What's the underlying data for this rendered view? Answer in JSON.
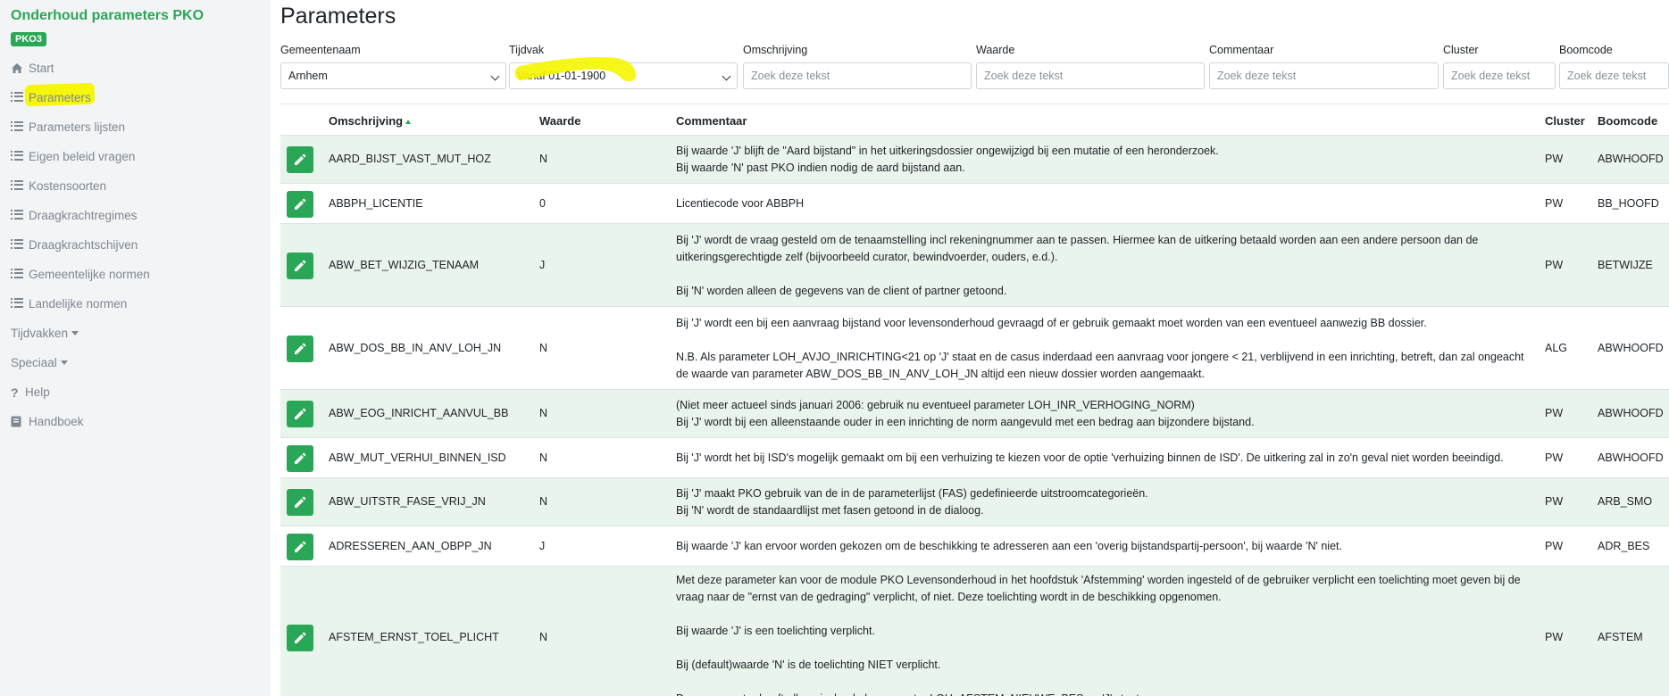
{
  "app": {
    "title": "Onderhoud parameters PKO",
    "badge": "PKO3"
  },
  "sidebar": {
    "items": [
      {
        "label": "Start",
        "icon": "home-icon"
      },
      {
        "label": "Parameters",
        "icon": "list-icon"
      },
      {
        "label": "Parameters lijsten",
        "icon": "list-icon"
      },
      {
        "label": "Eigen beleid vragen",
        "icon": "list-icon"
      },
      {
        "label": "Kostensoorten",
        "icon": "list-icon"
      },
      {
        "label": "Draagkrachtregimes",
        "icon": "list-icon"
      },
      {
        "label": "Draagkrachtschijven",
        "icon": "list-icon"
      },
      {
        "label": "Gemeentelijke normen",
        "icon": "list-icon"
      },
      {
        "label": "Landelijke normen",
        "icon": "list-icon"
      },
      {
        "label": "Tijdvakken",
        "icon": "dropdown-caret"
      },
      {
        "label": "Speciaal",
        "icon": "dropdown-caret"
      },
      {
        "label": "Help",
        "icon": "question-icon"
      },
      {
        "label": "Handboek",
        "icon": "book-icon"
      }
    ]
  },
  "page": {
    "title": "Parameters"
  },
  "filters": {
    "gemeentenaam": {
      "label": "Gemeentenaam",
      "value": "Arnhem"
    },
    "tijdvak": {
      "label": "Tijdvak",
      "value": "Vanaf 01-01-1900"
    },
    "omschrijving": {
      "label": "Omschrijving",
      "placeholder": "Zoek deze tekst"
    },
    "waarde": {
      "label": "Waarde",
      "placeholder": "Zoek deze tekst"
    },
    "commentaar": {
      "label": "Commentaar",
      "placeholder": "Zoek deze tekst"
    },
    "cluster": {
      "label": "Cluster",
      "placeholder": "Zoek deze tekst"
    },
    "boomcode": {
      "label": "Boomcode",
      "placeholder": "Zoek deze tekst"
    }
  },
  "table": {
    "headers": {
      "omschrijving": "Omschrijving",
      "waarde": "Waarde",
      "commentaar": "Commentaar",
      "cluster": "Cluster",
      "boomcode": "Boomcode"
    },
    "rows": [
      {
        "omschrijving": "AARD_BIJST_VAST_MUT_HOZ",
        "waarde": "N",
        "commentaar": "Bij waarde 'J' blijft de \"Aard bijstand\" in het uitkeringsdossier ongewijzigd bij een mutatie of een heronderzoek.\nBij waarde 'N' past PKO indien nodig de aard bijstand aan.",
        "cluster": "PW",
        "boomcode": "ABWHOOFD"
      },
      {
        "omschrijving": "ABBPH_LICENTIE",
        "waarde": "0",
        "commentaar": "Licentiecode voor ABBPH",
        "cluster": "PW",
        "boomcode": "BB_HOOFD"
      },
      {
        "omschrijving": "ABW_BET_WIJZIG_TENAAM",
        "waarde": "J",
        "commentaar": "Bij 'J' wordt de vraag gesteld om de tenaamstelling incl rekeningnummer aan te passen. Hiermee kan de uitkering betaald worden aan een andere persoon dan de\nuitkeringsgerechtigde zelf (bijvoorbeeld curator, bewindvoerder, ouders, e.d.).\n\nBij 'N' worden alleen de gegevens van de client of partner getoond.",
        "cluster": "PW",
        "boomcode": "BETWIJZE"
      },
      {
        "omschrijving": "ABW_DOS_BB_IN_ANV_LOH_JN",
        "waarde": "N",
        "commentaar": "Bij 'J' wordt een bij een aanvraag bijstand voor levensonderhoud gevraagd of er gebruik gemaakt moet worden van een eventueel aanwezig BB dossier.\n\nN.B. Als parameter LOH_AVJO_INRICHTING<21 op 'J' staat en de casus inderdaad een aanvraag voor jongere < 21, verblijvend in een inrichting, betreft, dan zal ongeacht\nde waarde van parameter ABW_DOS_BB_IN_ANV_LOH_JN altijd een nieuw dossier worden aangemaakt.",
        "cluster": "ALG",
        "boomcode": "ABWHOOFD"
      },
      {
        "omschrijving": "ABW_EOG_INRICHT_AANVUL_BB",
        "waarde": "N",
        "commentaar": "(Niet meer actueel sinds januari 2006: gebruik nu eventueel parameter LOH_INR_VERHOGING_NORM)\nBij 'J' wordt bij een alleenstaande ouder in een inrichting de norm aangevuld met een bedrag aan bijzondere bijstand.",
        "cluster": "PW",
        "boomcode": "ABWHOOFD"
      },
      {
        "omschrijving": "ABW_MUT_VERHUI_BINNEN_ISD",
        "waarde": "N",
        "commentaar": "Bij 'J' wordt het bij ISD's mogelijk gemaakt om bij een verhuizing te kiezen voor de optie 'verhuizing binnen de ISD'. De uitkering zal in zo'n geval niet worden beeindigd.",
        "cluster": "PW",
        "boomcode": "ABWHOOFD"
      },
      {
        "omschrijving": "ABW_UITSTR_FASE_VRIJ_JN",
        "waarde": "N",
        "commentaar": "Bij 'J' maakt PKO gebruik van de in de parameterlijst (FAS) gedefinieerde uitstroomcategorieën.\nBij 'N' wordt de standaardlijst met fasen getoond in de dialoog.",
        "cluster": "PW",
        "boomcode": "ARB_SMO"
      },
      {
        "omschrijving": "ADRESSEREN_AAN_OBPP_JN",
        "waarde": "J",
        "commentaar": "Bij waarde 'J' kan ervoor worden gekozen om de beschikking te adresseren aan een 'overig bijstandspartij-persoon', bij waarde 'N' niet.",
        "cluster": "PW",
        "boomcode": "ADR_BES"
      },
      {
        "omschrijving": "AFSTEM_ERNST_TOEL_PLICHT",
        "waarde": "N",
        "commentaar": "Met deze parameter kan voor de module PKO Levensonderhoud in het hoofdstuk 'Afstemming' worden ingesteld of de gebruiker verplicht een toelichting moet geven bij de\nvraag naar de \"ernst van de gedraging\" verplicht, of niet. Deze toelichting wordt in de beschikking opgenomen.\n\nBij waarde 'J' is een toelichting verplicht.\n\nBij (default)waarde 'N' is de toelichting NIET verplicht.\n\nDeze parameter heeft alleen invloed als parameter LOH_AFSTEM_NIEUWE_BES op 'J' staat.",
        "cluster": "PW",
        "boomcode": "AFSTEM"
      }
    ]
  }
}
